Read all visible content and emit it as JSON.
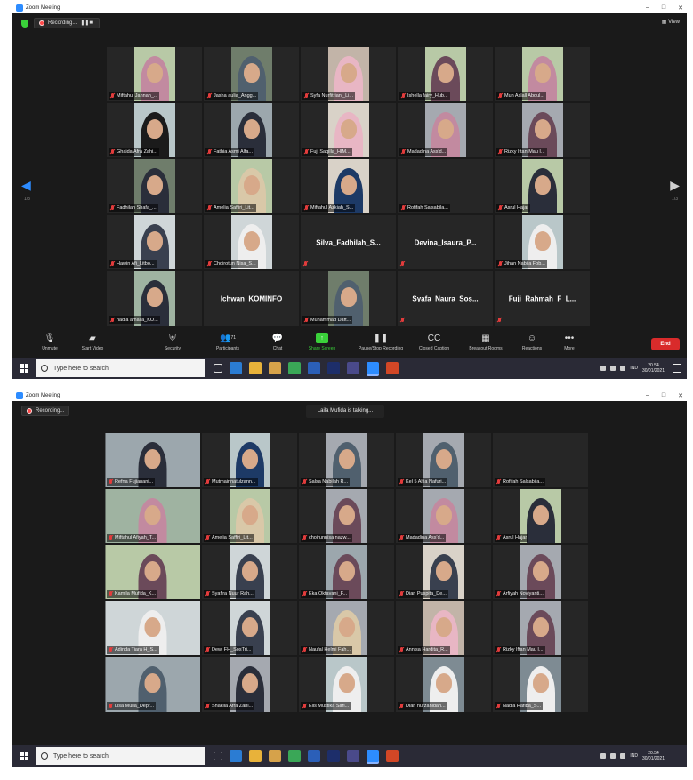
{
  "window_title": "Zoom Meeting",
  "window_controls": [
    "–",
    "□",
    "✕"
  ],
  "recording_label": "Recording...",
  "view_label": "View",
  "talking_label": "Laila Mufida is talking...",
  "page_indicator_left": "1/3",
  "page_indicator_right": "1/3",
  "colors": {
    "zoom_blue": "#2d8cff",
    "mute_red": "#e23c3c",
    "share_green": "#3ad13a",
    "end_red": "#d92b2b"
  },
  "toolbar": [
    {
      "label": "Unmute",
      "icon": "mic-muted-icon"
    },
    {
      "label": "Start Video",
      "icon": "video-off-icon"
    },
    {
      "label": "Security",
      "icon": "shield-icon"
    },
    {
      "label": "Participants",
      "icon": "participants-icon",
      "count": "71"
    },
    {
      "label": "Chat",
      "icon": "chat-icon"
    },
    {
      "label": "Share Screen",
      "icon": "share-screen-icon"
    },
    {
      "label": "Pause/Stop Recording",
      "icon": "pause-stop-icon"
    },
    {
      "label": "Closed Caption",
      "icon": "cc-icon"
    },
    {
      "label": "Breakout Rooms",
      "icon": "breakout-icon"
    },
    {
      "label": "Reactions",
      "icon": "reactions-icon"
    },
    {
      "label": "More",
      "icon": "more-icon"
    }
  ],
  "end_label": "End",
  "taskbar": {
    "search_placeholder": "Type here to search",
    "lang": "IND",
    "time": "20.54",
    "date": "30/01/2021"
  },
  "gallery1": [
    {
      "name": "Miftahul Jannah_...",
      "video": true
    },
    {
      "name": "Jasha aulia_Angg...",
      "video": true
    },
    {
      "name": "Syfa Nurfitriani_Li...",
      "video": true
    },
    {
      "name": "Ishella fairy_Hub...",
      "video": true
    },
    {
      "name": "Muh Aslall Abdul...",
      "video": true
    },
    {
      "name": "Ghaida Afra Zahi...",
      "video": true
    },
    {
      "name": "Fathia Asmi Alfa...",
      "video": true
    },
    {
      "name": "Fuji Saqilla_HIM...",
      "video": true
    },
    {
      "name": "Madadina Ass'd...",
      "video": true
    },
    {
      "name": "Rizky Iftan Mau I...",
      "video": true
    },
    {
      "name": "Fadhilah Shafa_...",
      "video": true
    },
    {
      "name": "Amelia Saffiri_Lit...",
      "video": true
    },
    {
      "name": "Miftahul Azkiah_S...",
      "video": true
    },
    {
      "name": "Rofifah Salsabila...",
      "video": false
    },
    {
      "name": "Asrul Hajar",
      "video": true
    },
    {
      "name": "Hawin Afi_Litbo...",
      "video": true
    },
    {
      "name": "Choirotun Nisa_S...",
      "video": true
    },
    {
      "name": "Silva_Fadhilah_S...",
      "video": false,
      "big": true
    },
    {
      "name": "Devina_Isaura_P...",
      "video": false,
      "big": true
    },
    {
      "name": "Jihan Nabila Fob...",
      "video": true
    },
    {
      "name": "nadia amalia_KO...",
      "video": true
    },
    {
      "name": "Ichwan_KOMINFO",
      "video": false,
      "big": true,
      "nomic": true
    },
    {
      "name": "Muhammad Daft...",
      "video": true
    },
    {
      "name": "Syafa_Naura_Sos...",
      "video": false,
      "big": true
    },
    {
      "name": "Fuji_Rahmah_F_L...",
      "video": false,
      "big": true
    }
  ],
  "gallery2": [
    {
      "name": "Refna Fujianani...",
      "video": true
    },
    {
      "name": "Mutmainnatulzann...",
      "video": true
    },
    {
      "name": "Salsa Nabilah R...",
      "video": true
    },
    {
      "name": "Kel 5 Alfia Nafuri...",
      "video": true
    },
    {
      "name": "Rofifah Salsabila...",
      "video": false
    },
    {
      "name": "Miftahul Afiyah_T...",
      "video": true
    },
    {
      "name": "Amelia Saffiri_Lit...",
      "video": true
    },
    {
      "name": "choirunnisa nazw...",
      "video": true
    },
    {
      "name": "Madadina Ass'd...",
      "video": true
    },
    {
      "name": "Asrul Hajar",
      "video": true
    },
    {
      "name": "Kamila Mufida_K...",
      "video": true
    },
    {
      "name": "Syafira Nuur Rah...",
      "video": true
    },
    {
      "name": "Eka Oktavani_F...",
      "video": true
    },
    {
      "name": "Dian Puspita_De...",
      "video": true
    },
    {
      "name": "Arfiyah Noviyanti...",
      "video": true
    },
    {
      "name": "Adinda Tiara H_S...",
      "video": true
    },
    {
      "name": "Dewi FH_SosTri...",
      "video": true
    },
    {
      "name": "Naufal Helmi Fah...",
      "video": true
    },
    {
      "name": "Annisa Hardita_R...",
      "video": true
    },
    {
      "name": "Rizky Iftan Mau I...",
      "video": true
    },
    {
      "name": "Lisa Mulia_Depr...",
      "video": true
    },
    {
      "name": "Shakila Afra Zahi...",
      "video": true
    },
    {
      "name": "Elis Mustika Sari...",
      "video": true
    },
    {
      "name": "Dian nurzahidah...",
      "video": true
    },
    {
      "name": "Nadia Hafiba_S...",
      "video": true
    }
  ]
}
